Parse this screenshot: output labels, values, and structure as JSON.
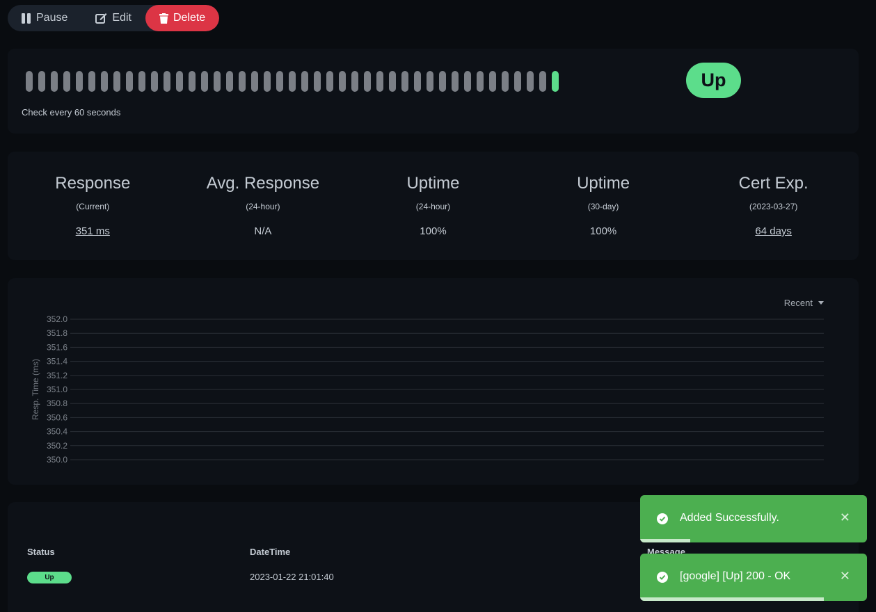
{
  "actions": {
    "pause_label": "Pause",
    "edit_label": "Edit",
    "delete_label": "Delete"
  },
  "heartbeat": {
    "beats": [
      "gray",
      "gray",
      "gray",
      "gray",
      "gray",
      "gray",
      "gray",
      "gray",
      "gray",
      "gray",
      "gray",
      "gray",
      "gray",
      "gray",
      "gray",
      "gray",
      "gray",
      "gray",
      "gray",
      "gray",
      "gray",
      "gray",
      "gray",
      "gray",
      "gray",
      "gray",
      "gray",
      "gray",
      "gray",
      "gray",
      "gray",
      "gray",
      "gray",
      "gray",
      "gray",
      "gray",
      "gray",
      "gray",
      "gray",
      "gray",
      "gray",
      "gray",
      "up"
    ],
    "check_text": "Check every 60 seconds",
    "status": "Up"
  },
  "stats": [
    {
      "title": "Response",
      "sub": "(Current)",
      "value": "351 ms",
      "link": true
    },
    {
      "title": "Avg. Response",
      "sub": "(24-hour)",
      "value": "N/A",
      "link": false
    },
    {
      "title": "Uptime",
      "sub": "(24-hour)",
      "value": "100%",
      "link": false
    },
    {
      "title": "Uptime",
      "sub": "(30-day)",
      "value": "100%",
      "link": false
    },
    {
      "title": "Cert Exp.",
      "sub": "(2023-03-27)",
      "value": "64 days",
      "link": true
    }
  ],
  "chart": {
    "period_label": "Recent"
  },
  "chart_data": {
    "type": "line",
    "ylabel": "Resp. Time (ms)",
    "ylim": [
      350.0,
      352.0
    ],
    "yticks": [
      "352.0",
      "351.8",
      "351.6",
      "351.4",
      "351.2",
      "351.0",
      "350.8",
      "350.6",
      "350.4",
      "350.2",
      "350.0"
    ],
    "grid": true,
    "series": []
  },
  "table": {
    "headers": {
      "status": "Status",
      "datetime": "DateTime",
      "message": "Message"
    },
    "rows": [
      {
        "status": "Up",
        "datetime": "2023-01-22 21:01:40",
        "message": ""
      }
    ]
  },
  "toasts": [
    {
      "message": "Added Successfully.",
      "progress": 0.22
    },
    {
      "message": "[google] [Up] 200 - OK",
      "progress": 0.81
    }
  ],
  "colors": {
    "up": "#5cdd8b",
    "danger": "#dc3545",
    "toast": "#4caf50"
  }
}
